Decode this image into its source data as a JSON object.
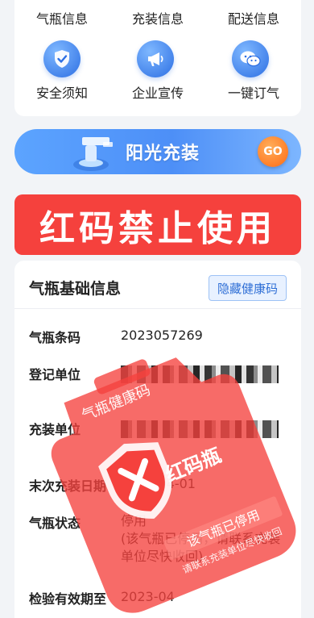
{
  "menu": {
    "row1": [
      "气瓶信息",
      "充装信息",
      "配送信息"
    ],
    "row2": [
      {
        "label": "安全须知",
        "icon": "shield-check-icon"
      },
      {
        "label": "企业宣传",
        "icon": "megaphone-icon"
      },
      {
        "label": "一键订气",
        "icon": "wechat-icon"
      }
    ]
  },
  "banner": {
    "title": "阳光充装",
    "go": "GO"
  },
  "red_code": {
    "text": "红码禁止使用"
  },
  "info": {
    "title": "气瓶基础信息",
    "hide_button": "隐藏健康码",
    "rows": [
      {
        "label": "气瓶条码",
        "value": "2023057269"
      },
      {
        "label": "登记单位",
        "value": ""
      },
      {
        "label": "充装单位",
        "value": ""
      },
      {
        "label": "末次充装日期",
        "value": "2023-04-01"
      },
      {
        "label": "气瓶状态",
        "value": "停用",
        "note": "(该气瓶已停用，请联系充装单位尽快收回)"
      },
      {
        "label": "检验有效期至",
        "value": "2023-04"
      }
    ]
  },
  "stamp": {
    "top_text": "气瓶健康码",
    "mid_text": "红码瓶",
    "bottom_text": "该气瓶已停用",
    "sub_text": "请联系充装单位尽快收回"
  },
  "colors": {
    "red": "#f5413d",
    "blue": "#4d8ff7",
    "orange": "#ff6a13"
  }
}
